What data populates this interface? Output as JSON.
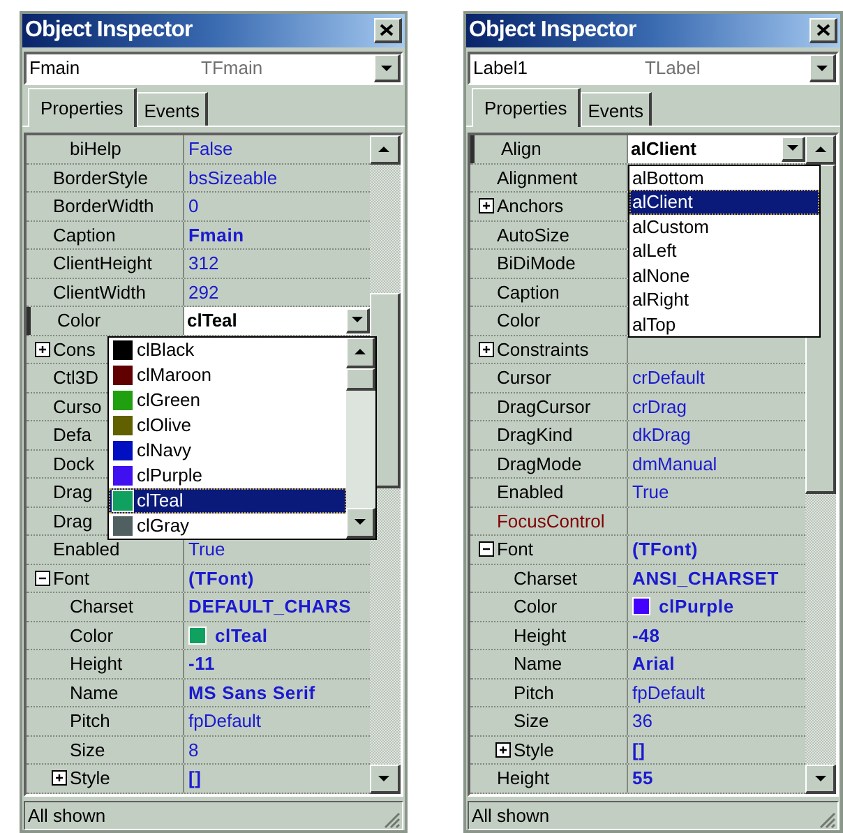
{
  "windows": [
    {
      "title": "Object Inspector",
      "object": {
        "name": "Fmain",
        "type": "TFmain"
      },
      "tabs": [
        {
          "label": "Properties",
          "selected": true
        },
        {
          "label": "Events",
          "selected": false
        }
      ],
      "rows": [
        {
          "kind": "sub-property",
          "name": "biHelp",
          "value": "False",
          "bold": false
        },
        {
          "kind": "property",
          "name": "BorderStyle",
          "value": "bsSizeable",
          "bold": false
        },
        {
          "kind": "property",
          "name": "BorderWidth",
          "value": "0",
          "bold": false
        },
        {
          "kind": "property",
          "name": "Caption",
          "value": "Fmain",
          "bold": true
        },
        {
          "kind": "property",
          "name": "ClientHeight",
          "value": "312",
          "bold": false
        },
        {
          "kind": "property",
          "name": "ClientWidth",
          "value": "292",
          "bold": false
        },
        {
          "kind": "editing",
          "name": "Color",
          "value": "clTeal",
          "bold": true
        },
        {
          "kind": "group",
          "name": "Cons",
          "expanded": false
        },
        {
          "kind": "property",
          "name": "Ctl3D"
        },
        {
          "kind": "property",
          "name": "Curso"
        },
        {
          "kind": "property",
          "name": "Defa"
        },
        {
          "kind": "property",
          "name": "Dock"
        },
        {
          "kind": "property",
          "name": "Drag"
        },
        {
          "kind": "property",
          "name": "Drag"
        },
        {
          "kind": "property",
          "name": "Enabled",
          "value": "True",
          "bold": false
        },
        {
          "kind": "group",
          "name": "Font",
          "value": "(TFont)",
          "bold": true,
          "expanded": true,
          "children": [
            {
              "kind": "property",
              "name": "Charset",
              "value": "DEFAULT_CHARS",
              "bold": true
            },
            {
              "kind": "property",
              "name": "Color",
              "value": "clTeal",
              "bold": true,
              "color": "#10a060"
            },
            {
              "kind": "property",
              "name": "Height",
              "value": "-11",
              "bold": true
            },
            {
              "kind": "property",
              "name": "Name",
              "value": "MS Sans Serif",
              "bold": true
            },
            {
              "kind": "property",
              "name": "Pitch",
              "value": "fpDefault",
              "bold": false
            },
            {
              "kind": "property",
              "name": "Size",
              "value": "8",
              "bold": false
            },
            {
              "kind": "group",
              "name": "Style",
              "value": "[]",
              "bold": true,
              "expanded": false
            }
          ]
        }
      ],
      "dropdown": [
        {
          "label": "clBlack",
          "color": "#000000",
          "selected": false
        },
        {
          "label": "clMaroon",
          "color": "#600000",
          "selected": false
        },
        {
          "label": "clGreen",
          "color": "#20a010",
          "selected": false
        },
        {
          "label": "clOlive",
          "color": "#606000",
          "selected": false
        },
        {
          "label": "clNavy",
          "color": "#0010c0",
          "selected": false
        },
        {
          "label": "clPurple",
          "color": "#4010f0",
          "selected": false
        },
        {
          "label": "clTeal",
          "color": "#10a060",
          "selected": true
        },
        {
          "label": "clGray",
          "color": "#506060",
          "selected": false
        }
      ],
      "status": "All shown"
    },
    {
      "title": "Object Inspector",
      "object": {
        "name": "Label1",
        "type": "TLabel"
      },
      "tabs": [
        {
          "label": "Properties",
          "selected": true
        },
        {
          "label": "Events",
          "selected": false
        }
      ],
      "rows": [
        {
          "kind": "editing",
          "name": "Align",
          "value": "alClient",
          "bold": true
        },
        {
          "kind": "property",
          "name": "Alignment"
        },
        {
          "kind": "group",
          "name": "Anchors",
          "expanded": false
        },
        {
          "kind": "property",
          "name": "AutoSize"
        },
        {
          "kind": "property",
          "name": "BiDiMode"
        },
        {
          "kind": "property",
          "name": "Caption"
        },
        {
          "kind": "property",
          "name": "Color"
        },
        {
          "kind": "group",
          "name": "Constraints",
          "expanded": false
        },
        {
          "kind": "property",
          "name": "Cursor",
          "value": "crDefault",
          "bold": false
        },
        {
          "kind": "property",
          "name": "DragCursor",
          "value": "crDrag",
          "bold": false
        },
        {
          "kind": "property",
          "name": "DragKind",
          "value": "dkDrag",
          "bold": false
        },
        {
          "kind": "property",
          "name": "DragMode",
          "value": "dmManual",
          "bold": false
        },
        {
          "kind": "property",
          "name": "Enabled",
          "value": "True",
          "bold": false
        },
        {
          "kind": "reference",
          "name": "FocusControl"
        },
        {
          "kind": "group",
          "name": "Font",
          "value": "(TFont)",
          "bold": true,
          "expanded": true,
          "children": [
            {
              "kind": "property",
              "name": "Charset",
              "value": "ANSI_CHARSET",
              "bold": true
            },
            {
              "kind": "property",
              "name": "Color",
              "value": "clPurple",
              "bold": true,
              "color": "#4400ff"
            },
            {
              "kind": "property",
              "name": "Height",
              "value": "-48",
              "bold": true
            },
            {
              "kind": "property",
              "name": "Name",
              "value": "Arial",
              "bold": true
            },
            {
              "kind": "property",
              "name": "Pitch",
              "value": "fpDefault",
              "bold": false
            },
            {
              "kind": "property",
              "name": "Size",
              "value": "36",
              "bold": false
            },
            {
              "kind": "group",
              "name": "Style",
              "value": "[]",
              "bold": true,
              "expanded": false
            }
          ]
        },
        {
          "kind": "property",
          "name": "Height",
          "value": "55",
          "bold": true
        }
      ],
      "dropdown": [
        {
          "label": "alBottom",
          "selected": false
        },
        {
          "label": "alClient",
          "selected": true
        },
        {
          "label": "alCustom",
          "selected": false
        },
        {
          "label": "alLeft",
          "selected": false
        },
        {
          "label": "alNone",
          "selected": false
        },
        {
          "label": "alRight",
          "selected": false
        },
        {
          "label": "alTop",
          "selected": false
        }
      ],
      "status": "All shown"
    }
  ]
}
